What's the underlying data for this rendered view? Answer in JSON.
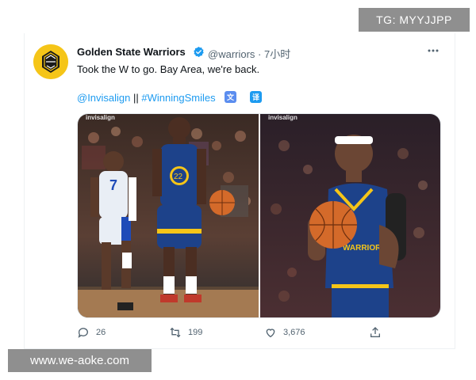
{
  "watermark_top": "TG: MYYJJPP",
  "watermark_bottom": "www.we-aoke.com",
  "tweet": {
    "author_name": "Golden State Warriors",
    "handle": "@warriors",
    "separator": "·",
    "time": "7小时",
    "text": "Took the W to go. Bay Area, we're back.",
    "mention_1": "@Invisalign",
    "divider": "||",
    "hashtag": "#WinningSmiles",
    "translate_icon_1": "文",
    "translate_icon_2": "译",
    "media_labels": [
      "invisalign",
      "invisalign"
    ],
    "actions": {
      "replies": "26",
      "retweets": "199",
      "likes": "3,676"
    }
  },
  "colors": {
    "link": "#1d9bf0",
    "verified": "#1d9bf0",
    "muted": "#536471",
    "warriors_blue": "#1d428a",
    "warriors_gold": "#f5c518"
  },
  "icons": {
    "more": "more-horizontal-icon",
    "reply": "reply-icon",
    "retweet": "retweet-icon",
    "like": "heart-icon",
    "share": "share-icon",
    "verified": "verified-badge-icon"
  }
}
